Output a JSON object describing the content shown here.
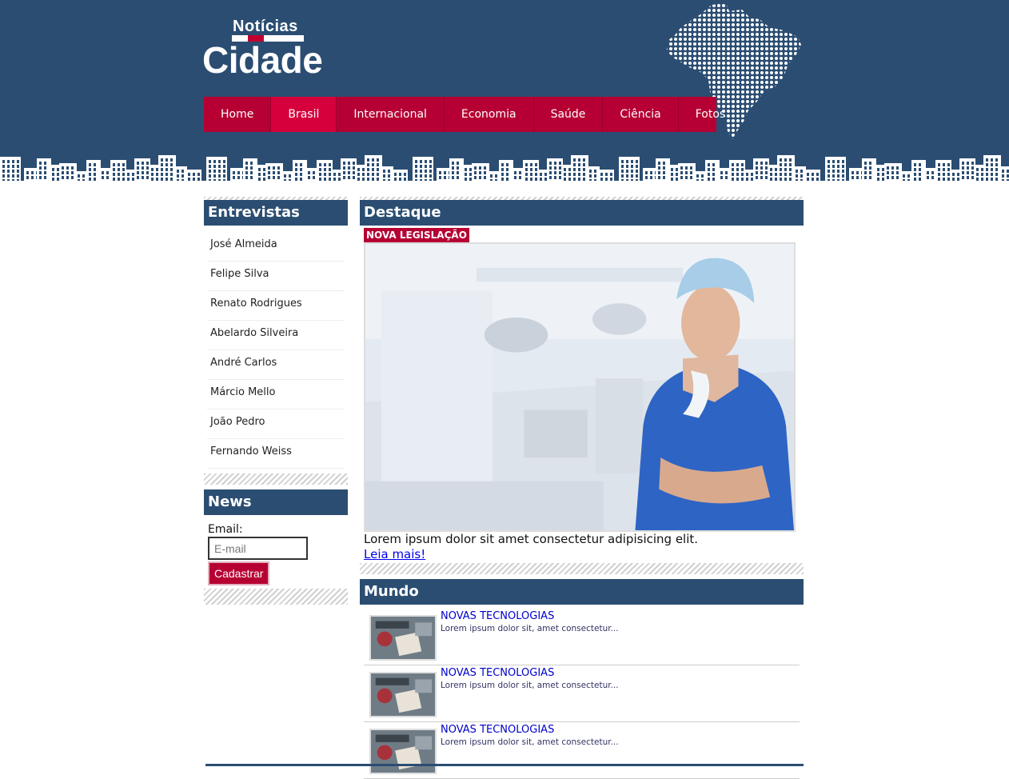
{
  "header": {
    "logo_top": "Notícias",
    "logo_bottom": "Cidade"
  },
  "nav": {
    "items": [
      {
        "label": "Home",
        "active": false
      },
      {
        "label": "Brasil",
        "active": true
      },
      {
        "label": "Internacional",
        "active": false
      },
      {
        "label": "Economia",
        "active": false
      },
      {
        "label": "Saúde",
        "active": false
      },
      {
        "label": "Ciência",
        "active": false
      },
      {
        "label": "Fotos",
        "active": false
      }
    ]
  },
  "sidebar": {
    "interviews_title": "Entrevistas",
    "interviews": [
      "José Almeida",
      "Felipe Silva",
      "Renato Rodrigues",
      "Abelardo Silveira",
      "André Carlos",
      "Márcio Mello",
      "João Pedro",
      "Fernando Weiss"
    ],
    "news_title": "News",
    "email_label": "Email:",
    "email_placeholder": "E-mail",
    "submit_label": "Cadastrar"
  },
  "featured": {
    "title": "Destaque",
    "badge": "NOVA LEGISLAÇÃO",
    "text": "Lorem ipsum dolor sit amet consectetur adipisicing elit.",
    "link": "Leia mais!"
  },
  "world": {
    "title": "Mundo",
    "items": [
      {
        "title": "NOVAS TECNOLOGIAS",
        "desc": "Lorem ipsum dolor sit, amet consectetur..."
      },
      {
        "title": "NOVAS TECNOLOGIAS",
        "desc": "Lorem ipsum dolor sit, amet consectetur..."
      },
      {
        "title": "NOVAS TECNOLOGIAS",
        "desc": "Lorem ipsum dolor sit, amet consectetur..."
      }
    ]
  },
  "colors": {
    "primary": "#2b4d72",
    "accent": "#b60033",
    "nav_active": "#d6003c"
  }
}
